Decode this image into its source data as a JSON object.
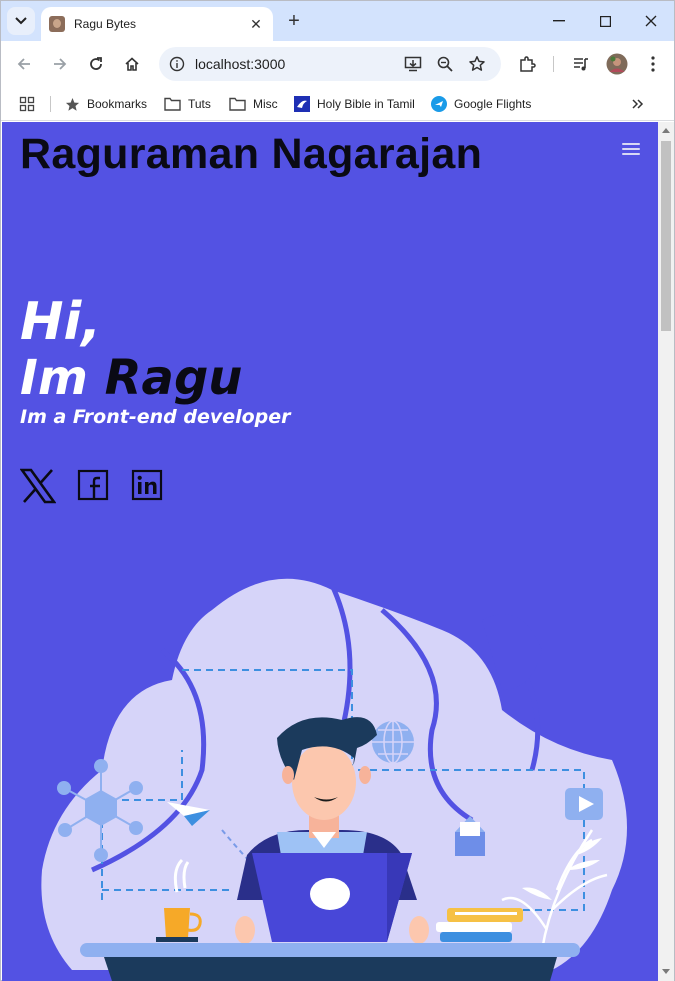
{
  "browser": {
    "tab_title": "Ragu Bytes",
    "url": "localhost:3000",
    "bookmarks": [
      {
        "label": "Bookmarks",
        "icon": "star-icon"
      },
      {
        "label": "Tuts",
        "icon": "folder-icon"
      },
      {
        "label": "Misc",
        "icon": "folder-icon"
      },
      {
        "label": "Holy Bible in Tamil",
        "icon": "bible-favicon"
      },
      {
        "label": "Google Flights",
        "icon": "flights-favicon"
      }
    ]
  },
  "site": {
    "name": "Raguraman Nagarajan",
    "hero": {
      "greeting": "Hi,",
      "intro_prefix": "Im ",
      "intro_name": "Ragu",
      "role": "Im a Front-end developer"
    },
    "social": [
      "x-icon",
      "facebook-icon",
      "linkedin-icon"
    ]
  },
  "colors": {
    "page_background": "#5352e3",
    "blob": "#d6d4f9",
    "accent_dark": "#1b3a5c",
    "tab_strip": "#d3e3fd"
  }
}
